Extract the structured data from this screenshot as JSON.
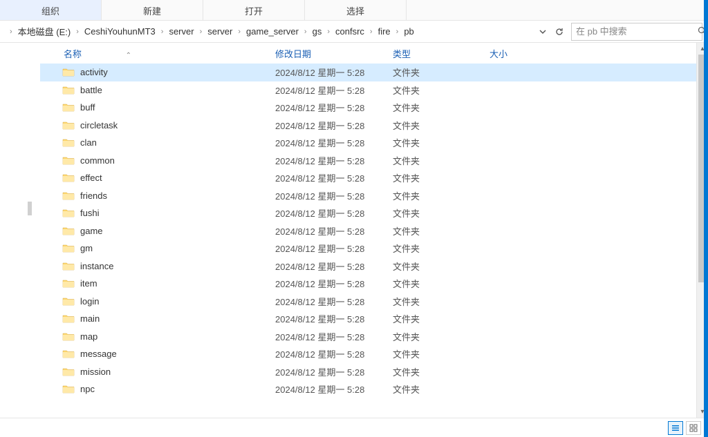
{
  "toolbar": {
    "organize": "组织",
    "new": "新建",
    "open": "打开",
    "select": "选择"
  },
  "breadcrumb": {
    "segments": [
      "本地磁盘 (E:)",
      "CeshiYouhunMT3",
      "server",
      "server",
      "game_server",
      "gs",
      "confsrc",
      "fire",
      "pb"
    ]
  },
  "search": {
    "placeholder": "在 pb 中搜索"
  },
  "columns": {
    "name": "名称",
    "date": "修改日期",
    "type": "类型",
    "size": "大小"
  },
  "common_date": "2024/8/12 星期一 5:28",
  "folder_type": "文件夹",
  "items": [
    {
      "name": "activity",
      "selected": true
    },
    {
      "name": "battle"
    },
    {
      "name": "buff"
    },
    {
      "name": "circletask"
    },
    {
      "name": "clan"
    },
    {
      "name": "common"
    },
    {
      "name": "effect"
    },
    {
      "name": "friends"
    },
    {
      "name": "fushi"
    },
    {
      "name": "game"
    },
    {
      "name": "gm"
    },
    {
      "name": "instance"
    },
    {
      "name": "item"
    },
    {
      "name": "login"
    },
    {
      "name": "main"
    },
    {
      "name": "map"
    },
    {
      "name": "message"
    },
    {
      "name": "mission"
    },
    {
      "name": "npc"
    }
  ]
}
